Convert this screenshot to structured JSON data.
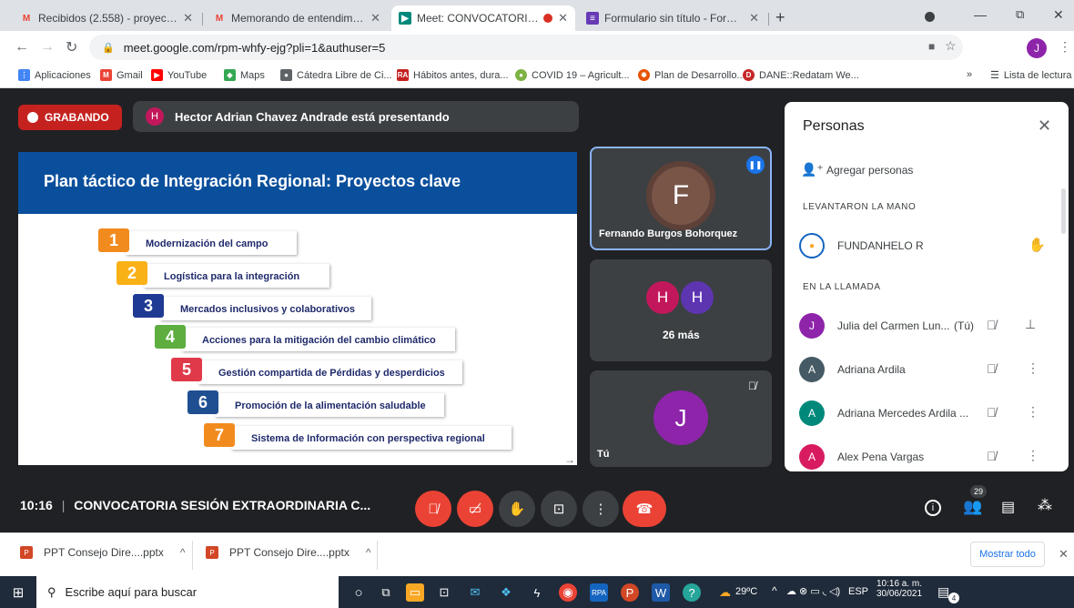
{
  "browser": {
    "tabs": [
      {
        "title": "Recibidos (2.558) - proyectosjulu",
        "icon": "gmail-icon",
        "active": false
      },
      {
        "title": "Memorando de entendimiento-C",
        "icon": "gmail-icon",
        "active": false
      },
      {
        "title": "Meet: CONVOCATORIA SESIÓ",
        "icon": "meet-icon",
        "active": true
      },
      {
        "title": "Formulario sin título - Formulario",
        "icon": "forms-icon",
        "active": false
      }
    ],
    "new_tab": "+",
    "url": "meet.google.com/rpm-whfy-ejg?pli=1&authuser=5",
    "profile_initial": "J",
    "bookmarks": [
      {
        "label": "Aplicaciones",
        "icon": "apps-icon",
        "color": "#4285f4"
      },
      {
        "label": "Gmail",
        "icon": "gmail-icon",
        "color": "#ea4335"
      },
      {
        "label": "YouTube",
        "icon": "youtube-icon",
        "color": "#ff0000"
      },
      {
        "label": "Maps",
        "icon": "maps-icon",
        "color": "#34a853"
      },
      {
        "label": "Cátedra Libre de Ci...",
        "icon": "globe-icon",
        "color": "#5f6368"
      },
      {
        "label": "Hábitos antes, dura...",
        "icon": "ra-icon",
        "color": "#c5221f"
      },
      {
        "label": "COVID 19 – Agricult...",
        "icon": "leaf-icon",
        "color": "#7cb342"
      },
      {
        "label": "Plan de Desarrollo...",
        "icon": "sun-icon",
        "color": "#e65100"
      },
      {
        "label": "DANE::Redatam We...",
        "icon": "dane-icon",
        "color": "#c62828"
      }
    ],
    "overflow": "»",
    "reading_list": "Lista de lectura"
  },
  "meet": {
    "recording_label": "GRABANDO",
    "presenter_initial": "H",
    "presenting_text": "Hector Adrian Chavez Andrade está presentando",
    "slide": {
      "title": "Plan táctico de Integración Regional: Proyectos clave",
      "items": [
        {
          "num": "1",
          "text": "Modernización del campo",
          "color": "#f28b1e"
        },
        {
          "num": "2",
          "text": "Logística para la integración",
          "color": "#f9b115"
        },
        {
          "num": "3",
          "text": "Mercados inclusivos y colaborativos",
          "color": "#1f3a93"
        },
        {
          "num": "4",
          "text": "Acciones para la mitigación del cambio climático",
          "color": "#5dad3f"
        },
        {
          "num": "5",
          "text": "Gestión compartida de Pérdidas y desperdicios",
          "color": "#e03a4a"
        },
        {
          "num": "6",
          "text": "Promoción de la alimentación saludable",
          "color": "#1f4f91"
        },
        {
          "num": "7",
          "text": "Sistema de Información con perspectiva regional",
          "color": "#f28b1e"
        }
      ]
    },
    "tiles": {
      "speaker_initial": "F",
      "speaker_name": "Fernando Burgos Bohorquez",
      "group_initials": [
        "H",
        "H"
      ],
      "more_label": "26 más",
      "self_initial": "J",
      "self_label": "Tú"
    },
    "people": {
      "title": "Personas",
      "add_label": "Agregar personas",
      "raised_section": "LEVANTARON LA MANO",
      "raised": [
        {
          "name": "FUNDANHELO R"
        }
      ],
      "call_section": "EN LA LLAMADA",
      "participants": [
        {
          "initial": "J",
          "name": "Julia del Carmen Lun...",
          "suffix": "(Tú)",
          "color": "#8e24aa"
        },
        {
          "initial": "A",
          "name": "Adriana Ardila",
          "suffix": "",
          "color": "#455a64"
        },
        {
          "initial": "A",
          "name": "Adriana Mercedes Ardila ...",
          "suffix": "",
          "color": "#00897b"
        },
        {
          "initial": "A",
          "name": "Alex Pena Vargas",
          "suffix": "",
          "color": "#d81b60"
        }
      ]
    },
    "bar": {
      "time": "10:16",
      "separator": "|",
      "meeting_title": "CONVOCATORIA SESIÓN EXTRAORDINARIA C...",
      "people_count": "29"
    }
  },
  "downloads": {
    "items": [
      {
        "name": "PPT Consejo Dire....pptx"
      },
      {
        "name": "PPT Consejo Dire....pptx"
      }
    ],
    "show_all": "Mostrar todo"
  },
  "taskbar": {
    "search_placeholder": "Escribe aquí para buscar",
    "weather": "29ºC",
    "language": "ESP",
    "time": "10:16 a. m.",
    "date": "30/06/2021",
    "notification_count": "4"
  }
}
